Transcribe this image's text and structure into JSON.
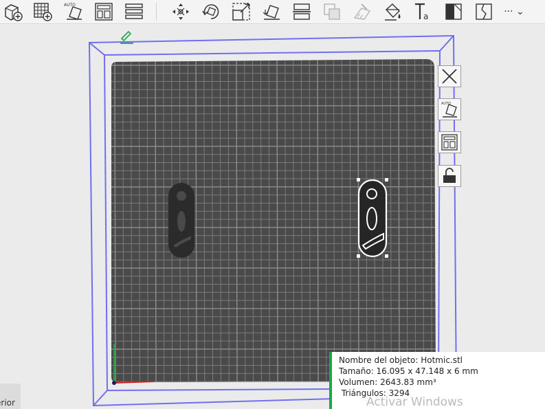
{
  "toolbar": {
    "buttons": [
      {
        "name": "add-object-button",
        "icon": "cube-plus-icon"
      },
      {
        "name": "add-plate-button",
        "icon": "grid-plus-icon"
      },
      {
        "name": "auto-orient-button",
        "icon": "auto-orient-icon",
        "label": "AUTO"
      },
      {
        "name": "arrange-button",
        "icon": "arrange-icon"
      },
      {
        "name": "split-button",
        "icon": "layers-icon"
      },
      {
        "name": "move-button",
        "icon": "move-arrows-icon"
      },
      {
        "name": "rotate-button",
        "icon": "rotate-icon"
      },
      {
        "name": "scale-button",
        "icon": "scale-icon"
      },
      {
        "name": "lay-on-face-button",
        "icon": "lay-on-face-icon"
      },
      {
        "name": "cut-button",
        "icon": "cut-icon"
      },
      {
        "name": "boolean-button",
        "icon": "boolean-icon"
      },
      {
        "name": "support-paint-button",
        "icon": "support-paint-icon"
      },
      {
        "name": "color-paint-button",
        "icon": "paint-bucket-icon"
      },
      {
        "name": "text-button",
        "icon": "text-icon",
        "label": "Ta"
      },
      {
        "name": "measure-button",
        "icon": "measure-icon"
      },
      {
        "name": "seam-button",
        "icon": "seam-icon"
      },
      {
        "name": "assembly-button",
        "icon": "cube-outline-icon"
      }
    ],
    "more_label": "··· ⌄"
  },
  "side_panel": {
    "buttons": [
      {
        "name": "close-plate-button",
        "icon": "close-icon"
      },
      {
        "name": "plate-auto-orient-button",
        "icon": "auto-orient-icon",
        "label": "AUTO"
      },
      {
        "name": "plate-arrange-button",
        "icon": "arrange-icon"
      },
      {
        "name": "plate-lock-button",
        "icon": "lock-open-icon"
      }
    ]
  },
  "object_info": {
    "name_line": "Nombre del objeto: Hotmic.stl",
    "size_line": "Tamaño: 16.095 x 47.148 x 6 mm",
    "volume_line": "Volumen: 2643.83 mm³",
    "triangles_line": " Triángulos: 3294"
  },
  "watermark": "Activar Windows",
  "corner_tab_label": "erior",
  "colors": {
    "bed": "#4a4a4a",
    "grid": "#7c7c7c",
    "bounds": "#6f6ff0",
    "info_accent": "#18a84a",
    "edit_icon": "#1aa84a"
  }
}
